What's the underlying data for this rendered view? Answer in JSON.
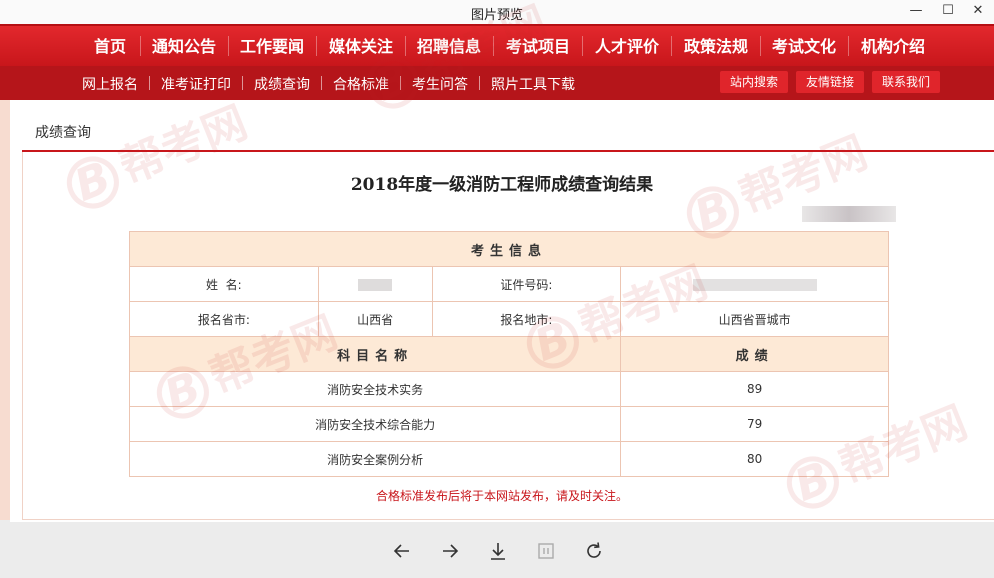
{
  "window": {
    "title": "图片预览",
    "minimize_glyph": "—",
    "maximize_glyph": "☐",
    "close_glyph": "✕"
  },
  "main_nav": [
    "首页",
    "通知公告",
    "工作要闻",
    "媒体关注",
    "招聘信息",
    "考试项目",
    "人才评价",
    "政策法规",
    "考试文化",
    "机构介绍"
  ],
  "sub_nav": [
    "网上报名",
    "准考证打印",
    "成绩查询",
    "合格标准",
    "考生问答",
    "照片工具下载"
  ],
  "sub_nav_buttons": [
    "站内搜索",
    "友情链接",
    "联系我们"
  ],
  "section_title": "成绩查询",
  "result_title": "2018年度一级消防工程师成绩查询结果",
  "table": {
    "candidate_header": "考生信息",
    "name_label": "姓  名:",
    "id_label": "证件号码:",
    "province_label": "报名省市:",
    "province_value": "山西省",
    "city_label": "报名地市:",
    "city_value": "山西省晋城市",
    "subject_header": "科目名称",
    "score_header": "成绩",
    "subjects": [
      {
        "name": "消防安全技术实务",
        "score": "89"
      },
      {
        "name": "消防安全技术综合能力",
        "score": "79"
      },
      {
        "name": "消防安全案例分析",
        "score": "80"
      }
    ]
  },
  "note": "合格标准发布后将于本网站发布，请及时关注。",
  "watermark": {
    "letter": "B",
    "text": "帮考网"
  },
  "colors": {
    "brand_red": "#c8161b",
    "header_fill": "#fde9d6",
    "border": "#ecc5b2"
  },
  "toolbar_icons": [
    "arrow-left-icon",
    "arrow-right-icon",
    "download-icon",
    "fit-icon",
    "rotate-icon"
  ]
}
